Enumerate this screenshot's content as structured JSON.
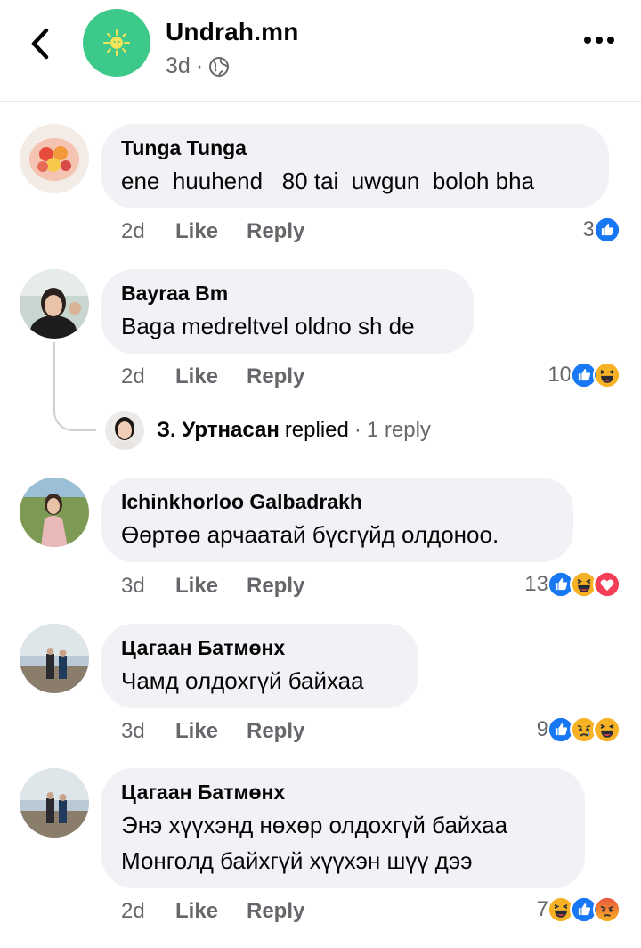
{
  "header": {
    "back_icon": "chevron-left-icon",
    "page_name": "Undrah.mn",
    "post_time": "3d",
    "separator": "·",
    "privacy_icon": "globe-icon",
    "more_icon": "more-horizontal-icon"
  },
  "actions": {
    "like_label": "Like",
    "reply_label": "Reply"
  },
  "comments": [
    {
      "author": "Tunga Tunga",
      "lines": [
        "ene  huuhend   80 tai  uwgun  boloh bha"
      ],
      "time": "2d",
      "reaction_count": "3",
      "reactions": [
        "like"
      ]
    },
    {
      "author": "Bayraa Bm",
      "lines": [
        "Baga medreltvel oldno sh de"
      ],
      "time": "2d",
      "reaction_count": "10",
      "reactions": [
        "like",
        "haha"
      ]
    },
    {
      "author": "Ichinkhorloo Galbadrakh",
      "lines": [
        "Өөртөө арчаатай бүсгүйд олдоноо."
      ],
      "time": "3d",
      "reaction_count": "13",
      "reactions": [
        "like",
        "haha",
        "love"
      ]
    },
    {
      "author": "Цагаан Батмөнх",
      "lines": [
        "Чамд олдохгүй байхаа"
      ],
      "time": "3d",
      "reaction_count": "9",
      "reactions": [
        "like",
        "sad",
        "haha"
      ]
    },
    {
      "author": "Цагаан Батмөнх",
      "lines": [
        "Энэ хүүхэнд нөхөр олдохгүй байхаа",
        "Монголд байхгүй хүүхэн шүү дээ"
      ],
      "time": "2d",
      "reaction_count": "7",
      "reactions": [
        "haha",
        "like",
        "angry"
      ]
    }
  ],
  "reply_preview": {
    "name": "З. Уртнасан",
    "verb": "replied",
    "separator": "·",
    "count": "1 reply"
  },
  "colors": {
    "like_blue": "#1877f2",
    "love_red": "#f33e58",
    "emoji_yellow": "#f7b125",
    "page_avatar_green": "#3cc98a",
    "bubble_gray": "#f0f2f5",
    "meta_gray": "#65676b"
  }
}
